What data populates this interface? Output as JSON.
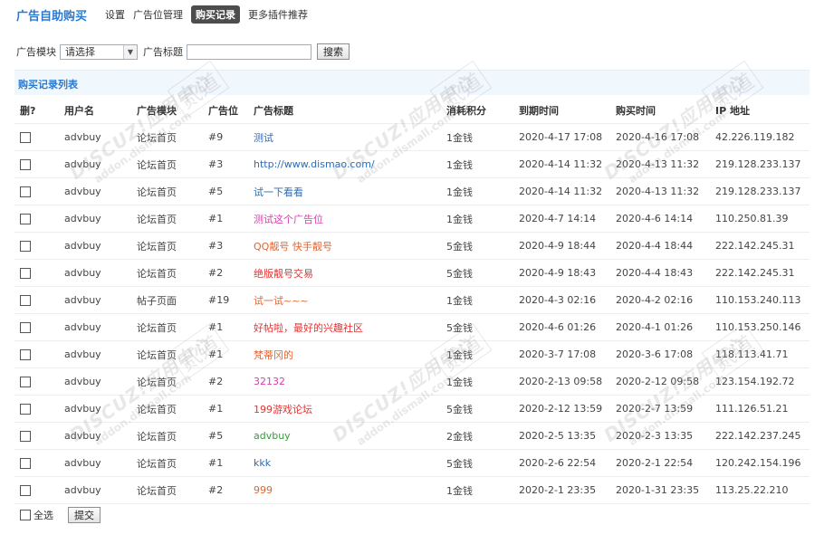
{
  "header": {
    "brand": "广告自助购买",
    "nav": [
      {
        "label": "设置",
        "active": false
      },
      {
        "label": "广告位管理",
        "active": false
      },
      {
        "label": "购买记录",
        "active": true
      },
      {
        "label": "更多插件推荐",
        "active": false
      }
    ]
  },
  "filter": {
    "module_label": "广告模块",
    "module_selected": "请选择",
    "title_label": "广告标题",
    "title_value": "",
    "search_label": "搜索"
  },
  "list": {
    "title": "购买记录列表",
    "columns": [
      "删?",
      "用户名",
      "广告模块",
      "广告位",
      "广告标题",
      "消耗积分",
      "到期时间",
      "购买时间",
      "IP 地址"
    ],
    "rows": [
      {
        "user": "advbuy",
        "module": "论坛首页",
        "slot": "#9",
        "title": "测试",
        "title_color": "#2b6cb8",
        "cost": "1金钱",
        "expire": "2020-4-17 17:08",
        "bought": "2020-4-16 17:08",
        "ip": "42.226.119.182"
      },
      {
        "user": "advbuy",
        "module": "论坛首页",
        "slot": "#3",
        "title": "http://www.dismao.com/",
        "title_color": "#2b6cb8",
        "cost": "1金钱",
        "expire": "2020-4-14 11:32",
        "bought": "2020-4-13 11:32",
        "ip": "219.128.233.137"
      },
      {
        "user": "advbuy",
        "module": "论坛首页",
        "slot": "#5",
        "title": "试一下看看",
        "title_color": "#2b6cb8",
        "cost": "1金钱",
        "expire": "2020-4-14 11:32",
        "bought": "2020-4-13 11:32",
        "ip": "219.128.233.137"
      },
      {
        "user": "advbuy",
        "module": "论坛首页",
        "slot": "#1",
        "title": "测试这个广告位",
        "title_color": "#d63fae",
        "cost": "1金钱",
        "expire": "2020-4-7 14:14",
        "bought": "2020-4-6 14:14",
        "ip": "110.250.81.39"
      },
      {
        "user": "advbuy",
        "module": "论坛首页",
        "slot": "#3",
        "title": "QQ靓号 快手靓号",
        "title_color": "#e8632c",
        "cost": "5金钱",
        "expire": "2020-4-9 18:44",
        "bought": "2020-4-4 18:44",
        "ip": "222.142.245.31"
      },
      {
        "user": "advbuy",
        "module": "论坛首页",
        "slot": "#2",
        "title": "绝版靓号交易",
        "title_color": "#e63333",
        "cost": "5金钱",
        "expire": "2020-4-9 18:43",
        "bought": "2020-4-4 18:43",
        "ip": "222.142.245.31"
      },
      {
        "user": "advbuy",
        "module": "帖子页面",
        "slot": "#19",
        "title": "试一试~~~",
        "title_color": "#e8632c",
        "cost": "1金钱",
        "expire": "2020-4-3 02:16",
        "bought": "2020-4-2 02:16",
        "ip": "110.153.240.113"
      },
      {
        "user": "advbuy",
        "module": "论坛首页",
        "slot": "#1",
        "title": "好帖啦，最好的兴趣社区",
        "title_color": "#e63333",
        "cost": "5金钱",
        "expire": "2020-4-6 01:26",
        "bought": "2020-4-1 01:26",
        "ip": "110.153.250.146"
      },
      {
        "user": "advbuy",
        "module": "论坛首页",
        "slot": "#1",
        "title": "梵蒂冈的",
        "title_color": "#e8632c",
        "cost": "1金钱",
        "expire": "2020-3-7 17:08",
        "bought": "2020-3-6 17:08",
        "ip": "118.113.41.71"
      },
      {
        "user": "advbuy",
        "module": "论坛首页",
        "slot": "#2",
        "title": "32132",
        "title_color": "#d63fae",
        "cost": "1金钱",
        "expire": "2020-2-13 09:58",
        "bought": "2020-2-12 09:58",
        "ip": "123.154.192.72"
      },
      {
        "user": "advbuy",
        "module": "论坛首页",
        "slot": "#1",
        "title": "199游戏论坛",
        "title_color": "#e63333",
        "cost": "5金钱",
        "expire": "2020-2-12 13:59",
        "bought": "2020-2-7 13:59",
        "ip": "111.126.51.21"
      },
      {
        "user": "advbuy",
        "module": "论坛首页",
        "slot": "#5",
        "title": "advbuy",
        "title_color": "#3a9a3a",
        "cost": "2金钱",
        "expire": "2020-2-5 13:35",
        "bought": "2020-2-3 13:35",
        "ip": "222.142.237.245"
      },
      {
        "user": "advbuy",
        "module": "论坛首页",
        "slot": "#1",
        "title": "kkk",
        "title_color": "#2b6cb8",
        "cost": "5金钱",
        "expire": "2020-2-6 22:54",
        "bought": "2020-2-1 22:54",
        "ip": "120.242.154.196"
      },
      {
        "user": "advbuy",
        "module": "论坛首页",
        "slot": "#2",
        "title": "999",
        "title_color": "#e8632c",
        "cost": "1金钱",
        "expire": "2020-2-1 23:35",
        "bought": "2020-1-31 23:35",
        "ip": "113.25.22.210"
      }
    ]
  },
  "footer": {
    "select_all_label": "全选",
    "submit_label": "提交"
  },
  "watermark": {
    "line1": "DISCUZ!应用中心",
    "line2": "addon.dismall.com",
    "mark": "贰道"
  },
  "colors": {
    "accent": "#2b7acf",
    "list_header_bg": "#f0f7fd",
    "active_tab_bg": "#4d4d4d"
  }
}
